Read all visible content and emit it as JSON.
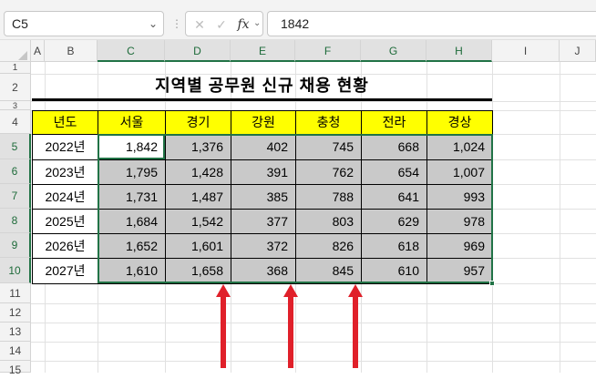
{
  "name_box": {
    "value": "C5"
  },
  "formula_bar": {
    "cancel_icon": "✕",
    "enter_icon": "✓",
    "fx_label": "fx",
    "value": "1842"
  },
  "columns": [
    "A",
    "B",
    "C",
    "D",
    "E",
    "F",
    "G",
    "H",
    "I",
    "J"
  ],
  "rows": [
    "1",
    "2",
    "3",
    "4",
    "5",
    "6",
    "7",
    "8",
    "9",
    "10",
    "11",
    "12",
    "13",
    "14",
    "15"
  ],
  "sheet": {
    "title": "지역별 공무원 신규 채용 현황",
    "headers": [
      "년도",
      "서울",
      "경기",
      "강원",
      "충청",
      "전라",
      "경상"
    ],
    "data": [
      {
        "year": "2022년",
        "values": [
          "1,842",
          "1,376",
          "402",
          "745",
          "668",
          "1,024"
        ]
      },
      {
        "year": "2023년",
        "values": [
          "1,795",
          "1,428",
          "391",
          "762",
          "654",
          "1,007"
        ]
      },
      {
        "year": "2024년",
        "values": [
          "1,731",
          "1,487",
          "385",
          "788",
          "641",
          "993"
        ]
      },
      {
        "year": "2025년",
        "values": [
          "1,684",
          "1,542",
          "377",
          "803",
          "629",
          "978"
        ]
      },
      {
        "year": "2026년",
        "values": [
          "1,652",
          "1,601",
          "372",
          "826",
          "618",
          "969"
        ]
      },
      {
        "year": "2027년",
        "values": [
          "1,610",
          "1,658",
          "368",
          "845",
          "610",
          "957"
        ]
      }
    ]
  },
  "colors": {
    "accent": "#217346",
    "header_fill": "#ffff00",
    "selected_fill": "#c9c9c9",
    "arrow": "#e0202a"
  }
}
